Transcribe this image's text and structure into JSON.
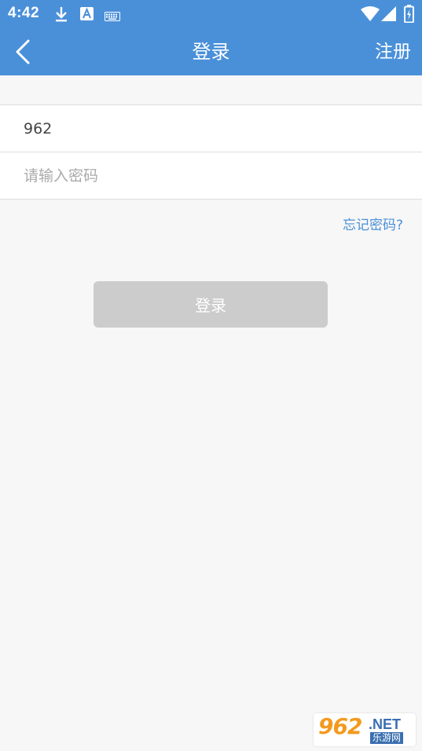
{
  "status_bar": {
    "time": "4:42",
    "icons": [
      "download-icon",
      "a-notification-icon",
      "keyboard-icon",
      "wifi-icon",
      "signal-icon",
      "battery-icon"
    ]
  },
  "app_bar": {
    "title": "登录",
    "register_label": "注册",
    "back_icon": "chevron-left-icon"
  },
  "form": {
    "account_value": "962",
    "password_placeholder": "请输入密码"
  },
  "forgot_label": "忘记密码?",
  "login_label": "登录",
  "watermark": {
    "main": "962",
    "net": ".NET",
    "sub": "乐游网"
  },
  "colors": {
    "primary": "#4a90d9",
    "button_disabled": "#cdcccc",
    "background": "#f7f7f7"
  }
}
